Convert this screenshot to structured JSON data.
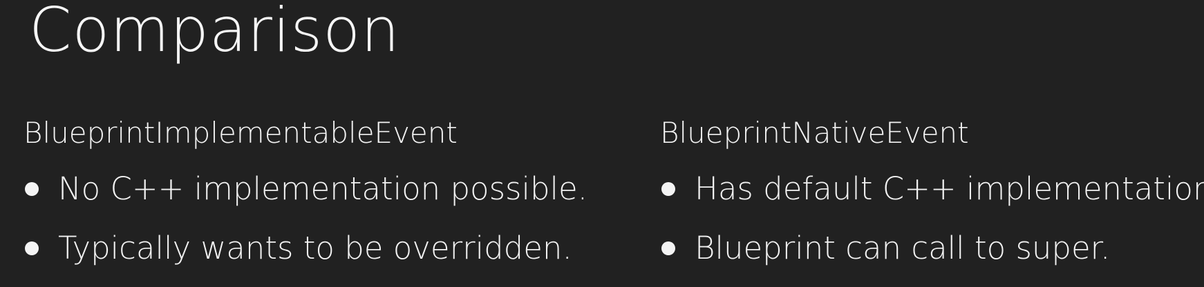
{
  "slide": {
    "title": "Comparison",
    "columns": [
      {
        "heading": "BlueprintImplementableEvent",
        "bullets": [
          "No C++ implementation possible.",
          "Typically wants to be overridden."
        ]
      },
      {
        "heading": "BlueprintNativeEvent",
        "bullets": [
          "Has default C++ implementation.",
          "Blueprint can call to super."
        ]
      }
    ]
  },
  "colors": {
    "background": "#212121",
    "text": "#f2f2f2"
  }
}
